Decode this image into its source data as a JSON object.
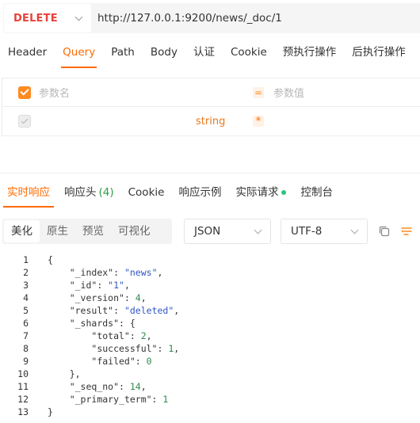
{
  "request": {
    "method": "DELETE",
    "url": "http://127.0.0.1:9200/news/_doc/1"
  },
  "request_tabs": [
    "Header",
    "Query",
    "Path",
    "Body",
    "认证",
    "Cookie",
    "预执行操作",
    "后执行操作"
  ],
  "active_request_tab": "Query",
  "params": {
    "name_placeholder": "参数名",
    "value_placeholder": "参数值",
    "row_type": "string",
    "eq_symbol": "=",
    "required_symbol": "*"
  },
  "response_tabs": {
    "realtime": "实时响应",
    "headers": "响应头",
    "headers_count": "(4)",
    "cookie": "Cookie",
    "examples": "响应示例",
    "actual_request": "实际请求",
    "console": "控制台"
  },
  "view_modes": [
    "美化",
    "原生",
    "预览",
    "可视化"
  ],
  "active_view_mode": "美化",
  "format_select": "JSON",
  "encoding_select": "UTF-8",
  "icons": {
    "copy": "copy-icon",
    "format": "format-icon"
  },
  "colors": {
    "accent": "#ff6a00",
    "method": "#e8413a",
    "string": "#2e57c4",
    "number": "#2f8a4e",
    "status_dot": "#2ec27e"
  },
  "code_lines": [
    {
      "n": "1",
      "indent": "",
      "parts": [
        {
          "t": "k",
          "v": "{"
        }
      ]
    },
    {
      "n": "2",
      "indent": "    ",
      "parts": [
        {
          "t": "k",
          "v": "\"_index\": "
        },
        {
          "t": "s",
          "v": "\"news\""
        },
        {
          "t": "k",
          "v": ","
        }
      ]
    },
    {
      "n": "3",
      "indent": "    ",
      "parts": [
        {
          "t": "k",
          "v": "\"_id\": "
        },
        {
          "t": "s",
          "v": "\"1\""
        },
        {
          "t": "k",
          "v": ","
        }
      ]
    },
    {
      "n": "4",
      "indent": "    ",
      "parts": [
        {
          "t": "k",
          "v": "\"_version\": "
        },
        {
          "t": "n",
          "v": "4"
        },
        {
          "t": "k",
          "v": ","
        }
      ]
    },
    {
      "n": "5",
      "indent": "    ",
      "parts": [
        {
          "t": "k",
          "v": "\"result\": "
        },
        {
          "t": "s",
          "v": "\"deleted\""
        },
        {
          "t": "k",
          "v": ","
        }
      ]
    },
    {
      "n": "6",
      "indent": "    ",
      "parts": [
        {
          "t": "k",
          "v": "\"_shards\": {"
        }
      ]
    },
    {
      "n": "7",
      "indent": "        ",
      "parts": [
        {
          "t": "k",
          "v": "\"total\": "
        },
        {
          "t": "n",
          "v": "2"
        },
        {
          "t": "k",
          "v": ","
        }
      ]
    },
    {
      "n": "8",
      "indent": "        ",
      "parts": [
        {
          "t": "k",
          "v": "\"successful\": "
        },
        {
          "t": "n",
          "v": "1"
        },
        {
          "t": "k",
          "v": ","
        }
      ]
    },
    {
      "n": "9",
      "indent": "        ",
      "parts": [
        {
          "t": "k",
          "v": "\"failed\": "
        },
        {
          "t": "n",
          "v": "0"
        }
      ]
    },
    {
      "n": "10",
      "indent": "    ",
      "parts": [
        {
          "t": "k",
          "v": "},"
        }
      ]
    },
    {
      "n": "11",
      "indent": "    ",
      "parts": [
        {
          "t": "k",
          "v": "\"_seq_no\": "
        },
        {
          "t": "n",
          "v": "14"
        },
        {
          "t": "k",
          "v": ","
        }
      ]
    },
    {
      "n": "12",
      "indent": "    ",
      "parts": [
        {
          "t": "k",
          "v": "\"_primary_term\": "
        },
        {
          "t": "n",
          "v": "1"
        }
      ]
    },
    {
      "n": "13",
      "indent": "",
      "parts": [
        {
          "t": "k",
          "v": "}"
        }
      ]
    }
  ]
}
